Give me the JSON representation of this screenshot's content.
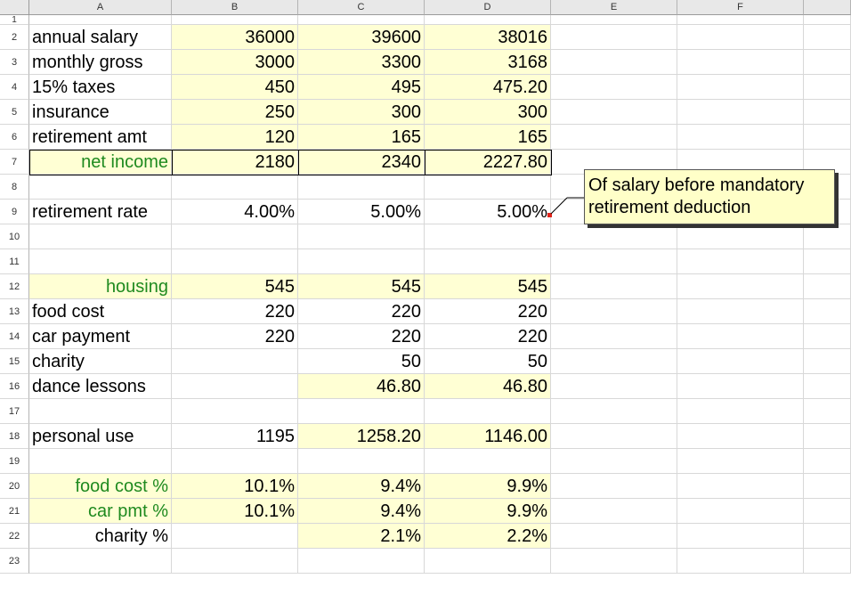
{
  "columns": [
    "A",
    "B",
    "C",
    "D",
    "E",
    "F"
  ],
  "rows": [
    "1",
    "2",
    "3",
    "4",
    "5",
    "6",
    "7",
    "8",
    "9",
    "10",
    "11",
    "12",
    "13",
    "14",
    "15",
    "16",
    "17",
    "18",
    "19",
    "20",
    "21",
    "22",
    "23"
  ],
  "cells": {
    "2": {
      "A": "annual salary",
      "B": "36000",
      "C": "39600",
      "D": "38016"
    },
    "3": {
      "A": "monthly gross",
      "B": "3000",
      "C": "3300",
      "D": "3168"
    },
    "4": {
      "A": "15% taxes",
      "B": "450",
      "C": "495",
      "D": "475.20"
    },
    "5": {
      "A": "insurance",
      "B": "250",
      "C": "300",
      "D": "300"
    },
    "6": {
      "A": "retirement amt",
      "B": "120",
      "C": "165",
      "D": "165"
    },
    "7": {
      "A": "net income",
      "B": "2180",
      "C": "2340",
      "D": "2227.80"
    },
    "9": {
      "A": "retirement rate",
      "B": "4.00%",
      "C": "5.00%",
      "D": "5.00%"
    },
    "12": {
      "A": "housing",
      "B": "545",
      "C": "545",
      "D": "545"
    },
    "13": {
      "A": "food cost",
      "B": "220",
      "C": "220",
      "D": "220"
    },
    "14": {
      "A": "car payment",
      "B": "220",
      "C": "220",
      "D": "220"
    },
    "15": {
      "A": "charity",
      "C": "50",
      "D": "50"
    },
    "16": {
      "A": "dance lessons",
      "C": "46.80",
      "D": "46.80"
    },
    "18": {
      "A": "personal use",
      "B": "1195",
      "C": "1258.20",
      "D": "1146.00"
    },
    "20": {
      "A": "food cost %",
      "B": "10.1%",
      "C": "9.4%",
      "D": "9.9%"
    },
    "21": {
      "A": "car pmt %",
      "B": "10.1%",
      "C": "9.4%",
      "D": "9.9%"
    },
    "22": {
      "A": "charity %",
      "C": "2.1%",
      "D": "2.2%"
    }
  },
  "comment": {
    "text": "Of salary before mandatory retirement deduction",
    "cell": "D9"
  },
  "colors": {
    "highlight": "#ffffd4",
    "green_label": "#1f8a1f",
    "comment_bg": "#ffffc8",
    "comment_indicator": "#e0241b"
  }
}
